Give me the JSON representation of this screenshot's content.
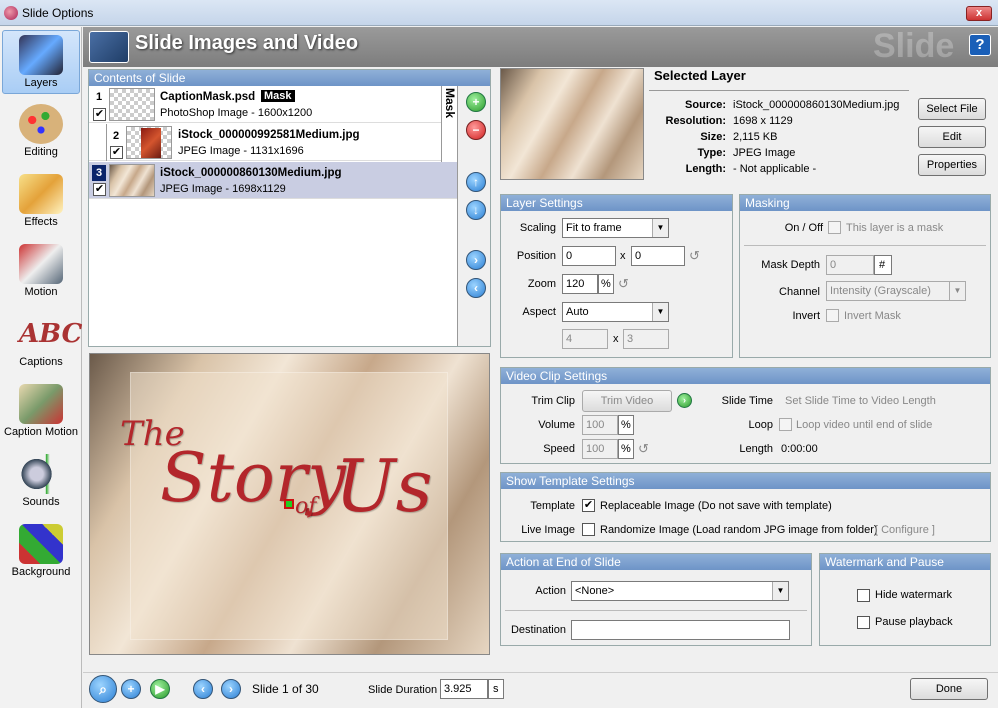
{
  "window": {
    "title": "Slide Options",
    "close_label": "x"
  },
  "header": {
    "title": "Slide Images and Video",
    "watermark": "Slide",
    "help_label": "?"
  },
  "sidebar": {
    "items": [
      {
        "label": "Layers",
        "icon": "layers-icon",
        "selected": true
      },
      {
        "label": "Editing",
        "icon": "editing-palette-icon"
      },
      {
        "label": "Effects",
        "icon": "effects-icon"
      },
      {
        "label": "Motion",
        "icon": "motion-icon"
      },
      {
        "label": "Captions",
        "icon": "captions-abc-icon"
      },
      {
        "label": "Caption Motion",
        "icon": "caption-motion-icon"
      },
      {
        "label": "Sounds",
        "icon": "sounds-speaker-icon"
      },
      {
        "label": "Background",
        "icon": "background-paint-icon"
      }
    ]
  },
  "contents": {
    "title": "Contents of Slide",
    "mask_tab": "Mask",
    "layers": [
      {
        "num": "1",
        "name": "CaptionMask.psd",
        "badge": "Mask",
        "desc": "PhotoShop Image - 1600x1200",
        "checked": true
      },
      {
        "num": "2",
        "name": "iStock_000000992581Medium.jpg",
        "desc": "JPEG Image - 1131x1696",
        "checked": true
      },
      {
        "num": "3",
        "name": "iStock_000000860130Medium.jpg",
        "desc": "JPEG Image - 1698x1129",
        "checked": true
      }
    ]
  },
  "preview": {
    "line1": "The",
    "line2": "Story",
    "line3": "of",
    "line4": "Us"
  },
  "selected_layer": {
    "title": "Selected Layer",
    "source_label": "Source:",
    "source": "iStock_000000860130Medium.jpg",
    "resolution_label": "Resolution:",
    "resolution": "1698 x 1129",
    "size_label": "Size:",
    "size": "2,115 KB",
    "type_label": "Type:",
    "type": "JPEG Image",
    "length_label": "Length:",
    "length": "- Not applicable -",
    "select_file": "Select File",
    "edit": "Edit",
    "properties": "Properties"
  },
  "layer_settings": {
    "title": "Layer Settings",
    "scaling_label": "Scaling",
    "scaling": "Fit to frame",
    "position_label": "Position",
    "pos_x": "0",
    "pos_y": "0",
    "x_sep": "x",
    "zoom_label": "Zoom",
    "zoom": "120",
    "pct": "%",
    "aspect_label": "Aspect",
    "aspect": "Auto",
    "aspect_w": "4",
    "aspect_h": "3"
  },
  "masking": {
    "title": "Masking",
    "onoff_label": "On / Off",
    "is_mask": "This layer is a mask",
    "depth_label": "Mask Depth",
    "depth": "0",
    "hash": "#",
    "channel_label": "Channel",
    "channel": "Intensity (Grayscale)",
    "invert_label": "Invert",
    "invert_mask": "Invert Mask"
  },
  "video": {
    "title": "Video Clip Settings",
    "trim_label": "Trim Clip",
    "trim_btn": "Trim Video",
    "volume_label": "Volume",
    "volume": "100",
    "speed_label": "Speed",
    "speed": "100",
    "slide_time_label": "Slide Time",
    "slide_time_link": "Set Slide Time to Video Length",
    "loop_label": "Loop",
    "loop_text": "Loop video until end of slide",
    "length_label": "Length",
    "length": "0:00:00"
  },
  "template": {
    "title": "Show Template Settings",
    "template_label": "Template",
    "replaceable": "Replaceable Image (Do not save with template)",
    "live_label": "Live Image",
    "randomize": "Randomize Image (Load random JPG image from folder)",
    "configure": "[ Configure ]"
  },
  "action": {
    "title": "Action at End of Slide",
    "action_label": "Action",
    "action_value": "<None>",
    "destination_label": "Destination",
    "destination_value": ""
  },
  "watermark": {
    "title": "Watermark and Pause",
    "hide": "Hide watermark",
    "pause": "Pause playback"
  },
  "bottom": {
    "slide_counter": "Slide 1 of 30",
    "duration_label": "Slide Duration",
    "duration": "3.925",
    "unit": "s",
    "done": "Done"
  }
}
